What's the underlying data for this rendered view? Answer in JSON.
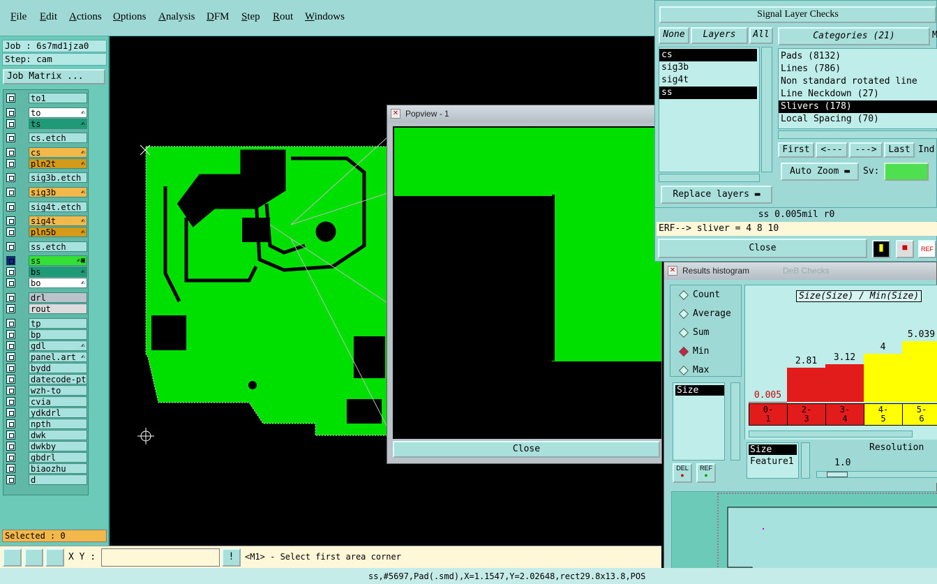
{
  "menu": [
    "File",
    "Edit",
    "Actions",
    "Options",
    "Analysis",
    "DFM",
    "Step",
    "Rout",
    "Windows"
  ],
  "job": {
    "job_label": "Job : 6s7md1jza0",
    "step_label": "Step: cam",
    "matrix_button": "Job Matrix ..."
  },
  "layers": [
    {
      "name": "to1",
      "color": "#a8e2de",
      "flag": ""
    },
    {
      "name": "to",
      "color": "#ffffff",
      "flag": "✍"
    },
    {
      "name": "ts",
      "color": "#1f9a77",
      "flag": "✍"
    },
    {
      "name": "cs.etch",
      "color": "#a8e2de",
      "flag": ""
    },
    {
      "name": "cs",
      "color": "#f2b84a",
      "flag": "✍"
    },
    {
      "name": "pln2t",
      "color": "#d69a1a",
      "flag": "✍"
    },
    {
      "name": "sig3b.etch",
      "color": "#a8e2de",
      "flag": ""
    },
    {
      "name": "sig3b",
      "color": "#f2b84a",
      "flag": "✍"
    },
    {
      "name": "sig4t.etch",
      "color": "#a8e2de",
      "flag": ""
    },
    {
      "name": "sig4t",
      "color": "#f2b84a",
      "flag": "✍"
    },
    {
      "name": "pln5b",
      "color": "#d69a1a",
      "flag": "✍"
    },
    {
      "name": "ss.etch",
      "color": "#a8e2de",
      "flag": ""
    },
    {
      "name": "ss",
      "color": "#33e033",
      "flag": "✍▣"
    },
    {
      "name": "bs",
      "color": "#1f9a77",
      "flag": "✍"
    },
    {
      "name": "bo",
      "color": "#ffffff",
      "flag": "✍"
    },
    {
      "name": "drl",
      "color": "#b9c3c9",
      "flag": ""
    },
    {
      "name": "rout",
      "color": "#dcdcdc",
      "flag": ""
    },
    {
      "name": "tp",
      "color": "#a8e2de",
      "flag": ""
    },
    {
      "name": "bp",
      "color": "#a8e2de",
      "flag": ""
    },
    {
      "name": "gdl",
      "color": "#a8e2de",
      "flag": "✍"
    },
    {
      "name": "panel.art",
      "color": "#a8e2de",
      "flag": "✍"
    },
    {
      "name": "bydd",
      "color": "#a8e2de",
      "flag": ""
    },
    {
      "name": "datecode-pt",
      "color": "#a8e2de",
      "flag": ""
    },
    {
      "name": "wzh-to",
      "color": "#a8e2de",
      "flag": ""
    },
    {
      "name": "cvia",
      "color": "#a8e2de",
      "flag": ""
    },
    {
      "name": "ydkdrl",
      "color": "#a8e2de",
      "flag": ""
    },
    {
      "name": "npth",
      "color": "#a8e2de",
      "flag": ""
    },
    {
      "name": "dwk",
      "color": "#a8e2de",
      "flag": ""
    },
    {
      "name": "dwkby",
      "color": "#a8e2de",
      "flag": ""
    },
    {
      "name": "gbdrl",
      "color": "#a8e2de",
      "flag": ""
    },
    {
      "name": "biaozhu",
      "color": "#a8e2de",
      "flag": ""
    },
    {
      "name": "d",
      "color": "#a8e2de",
      "flag": ""
    }
  ],
  "selected": "Selected : 0",
  "bottom": {
    "xy_label": "X Y :",
    "xy_value": "",
    "exclaim": "!",
    "prompt": "<M1> - Select first area corner"
  },
  "status": "ss,#5697,Pad(.smd),X=1.1547,Y=2.02648,rect29.8x13.8,POS",
  "popview": {
    "title": "Popview - 1",
    "close": "Close"
  },
  "slc": {
    "title": "Signal Layer Checks",
    "none": "None",
    "layers_label": "Layers",
    "all": "All",
    "layer_items": [
      {
        "name": "cs",
        "sel": true
      },
      {
        "name": "sig3b",
        "sel": false
      },
      {
        "name": "sig4t",
        "sel": false
      },
      {
        "name": "ss",
        "sel": true
      }
    ],
    "categories_label": "Categories (21)",
    "m_label": "M",
    "categories": [
      {
        "text": "Pads (8132)",
        "sel": false
      },
      {
        "text": "Lines (786)",
        "sel": false
      },
      {
        "text": "Non standard rotated line",
        "sel": false
      },
      {
        "text": "Line Neckdown (27)",
        "sel": false
      },
      {
        "text": "Slivers (178)",
        "sel": true
      },
      {
        "text": "Local Spacing (70)",
        "sel": false
      }
    ],
    "nav": [
      "First",
      "<---",
      "--->",
      "Last"
    ],
    "nav_extra": "Ind",
    "auto_zoom": "Auto Zoom",
    "sv_label": "Sv:",
    "replace": "Replace layers",
    "info": "ss 0.005mil  r0",
    "erf": "ERF--> sliver = 4 8 10",
    "close": "Close",
    "icon_ref": "REF"
  },
  "hist": {
    "title": "Results histogram",
    "ghost_title": "DeB Checks",
    "radios": [
      {
        "label": "Count",
        "on": false
      },
      {
        "label": "Average",
        "on": false
      },
      {
        "label": "Sum",
        "on": false
      },
      {
        "label": "Min",
        "on": true
      },
      {
        "label": "Max",
        "on": false
      }
    ],
    "chart_label": "Size(Size) / Min(Size)",
    "size_list": [
      "Size"
    ],
    "del": "DEL",
    "ref": "REF",
    "size_label": "Size",
    "feature_label": "Feature1",
    "resolution_label": "Resolution",
    "resolution_value": "1.0"
  },
  "chart_data": {
    "type": "bar",
    "title": "Size(Size) / Min(Size)",
    "categories": [
      "0-1",
      "2-3",
      "3-4",
      "4-5",
      "5-6"
    ],
    "values": [
      0.005,
      2.81,
      3.12,
      4,
      5.039
    ],
    "value_labels": [
      "0.005",
      "2.81",
      "3.12",
      "4",
      "5.039"
    ],
    "colors": [
      "#e21b1b",
      "#e21b1b",
      "#e21b1b",
      "#ffff00",
      "#ffff00"
    ]
  }
}
